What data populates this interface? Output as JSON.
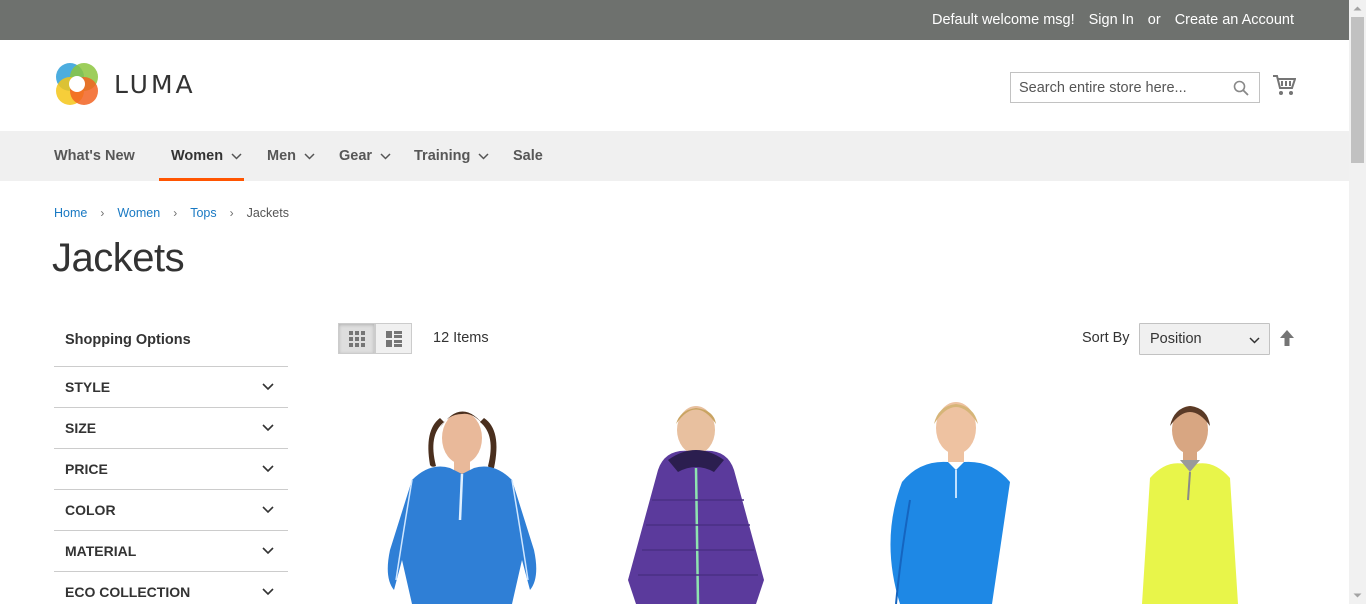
{
  "topbar": {
    "welcome": "Default welcome msg!",
    "sign_in": "Sign In",
    "or": "or",
    "create_account": "Create an Account",
    "background": "#6e716e"
  },
  "header": {
    "logo_text": "LUMA",
    "search_placeholder": "Search entire store here...",
    "search_icon": "search-icon",
    "cart_icon": "cart-icon"
  },
  "nav": {
    "items": [
      {
        "label": "What's New",
        "has_dropdown": false
      },
      {
        "label": "Women",
        "has_dropdown": true,
        "active": true
      },
      {
        "label": "Men",
        "has_dropdown": true
      },
      {
        "label": "Gear",
        "has_dropdown": true
      },
      {
        "label": "Training",
        "has_dropdown": true
      },
      {
        "label": "Sale",
        "has_dropdown": false
      }
    ],
    "active_color": "#ff5501"
  },
  "breadcrumbs": [
    "Home",
    "Women",
    "Tops",
    "Jackets"
  ],
  "page_title": "Jackets",
  "sidebar": {
    "title": "Shopping Options",
    "filters": [
      "STYLE",
      "SIZE",
      "PRICE",
      "COLOR",
      "MATERIAL",
      "ECO COLLECTION"
    ]
  },
  "toolbar": {
    "amount": "12 Items",
    "sort_label": "Sort By",
    "sort_value": "Position",
    "view_modes": [
      "grid-icon",
      "list-icon"
    ],
    "sort_direction_icon": "arrow-up-icon"
  },
  "products": [
    {
      "image": "blue-half-zip-jacket",
      "color": "#2f7fd6"
    },
    {
      "image": "purple-puffer-jacket",
      "color": "#5b3a9c"
    },
    {
      "image": "blue-pullover-jacket",
      "color": "#1e88e5"
    },
    {
      "image": "neon-yellow-jacket",
      "color": "#e8f54a"
    }
  ]
}
